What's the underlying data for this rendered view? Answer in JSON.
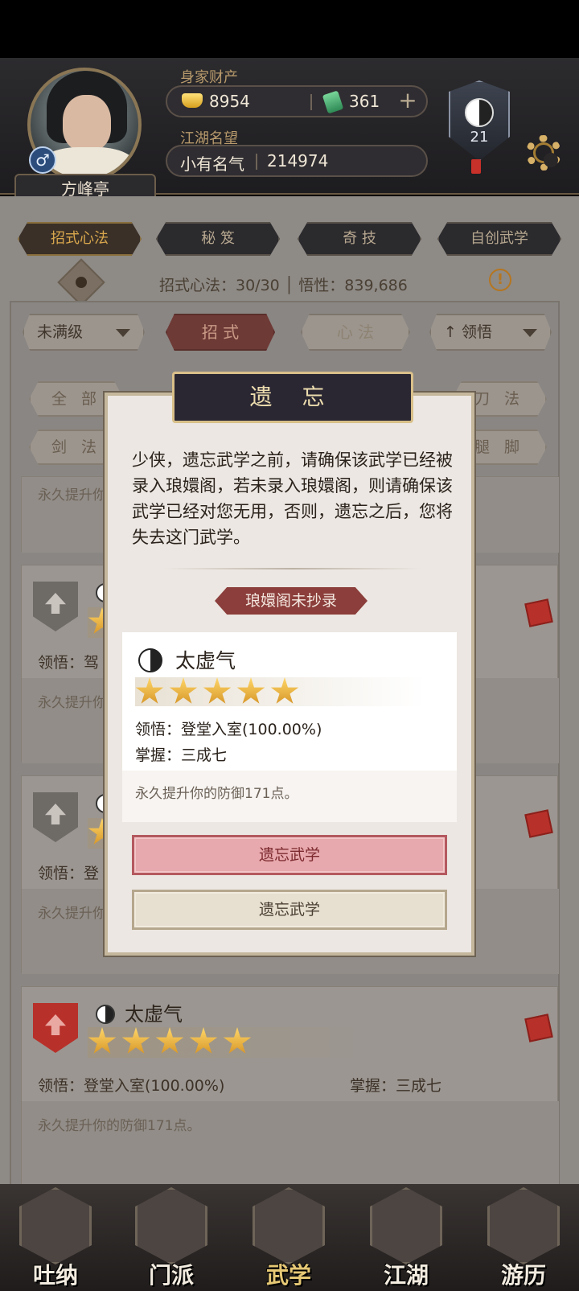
{
  "header": {
    "player_name": "方峰亭",
    "gender_symbol": "♂",
    "wealth_label": "身家财产",
    "gold": "8954",
    "jade": "361",
    "plus": "+",
    "fame_label": "江湖名望",
    "fame_title": "小有名气",
    "fame_value": "214974",
    "level": "21"
  },
  "top_tabs": [
    "招式心法",
    "秘 笈",
    "奇 技",
    "自创武学"
  ],
  "info": {
    "text": "招式心法：30/30 │ 悟性：839,686",
    "warn": "!"
  },
  "filters": {
    "dropdown_left": "未满级",
    "tab_moves": "招 式",
    "tab_mind": "心 法",
    "dropdown_right": "↑ 领悟"
  },
  "categories": [
    "全 部",
    "刀 法",
    "剑 法",
    "腿 脚"
  ],
  "cards": [
    {
      "desc": "永久提升你"
    },
    {
      "line1": "领悟：驾",
      "desc": "永久提升你"
    },
    {
      "line1": "领悟：登",
      "desc": "永久提升你"
    },
    {
      "name": "太虚气",
      "line1": "领悟：登堂入室(100.00%)",
      "line2": "掌握：三成七",
      "desc": "永久提升你的防御171点。"
    }
  ],
  "modal": {
    "title": "遗 忘",
    "desc": "少侠，遗忘武学之前，请确保该武学已经被录入琅嬛阁，若未录入琅嬛阁，则请确保该武学已经对您无用，否则，遗忘之后，您将失去这门武学。",
    "tag": "琅嬛阁未抄录",
    "skill_name": "太虚气",
    "stars": 5,
    "comprehension": "领悟：登堂入室(100.00%)",
    "mastery": "掌握：三成七",
    "effect": "永久提升你的防御171点。",
    "btn_red": "遗忘武学",
    "btn_plain": "遗忘武学"
  },
  "bottom_nav": [
    "吐纳",
    "门派",
    "武学",
    "江湖",
    "游历"
  ],
  "colors": {
    "accent_gold": "#d8a64d",
    "danger_red": "#b8302a"
  }
}
